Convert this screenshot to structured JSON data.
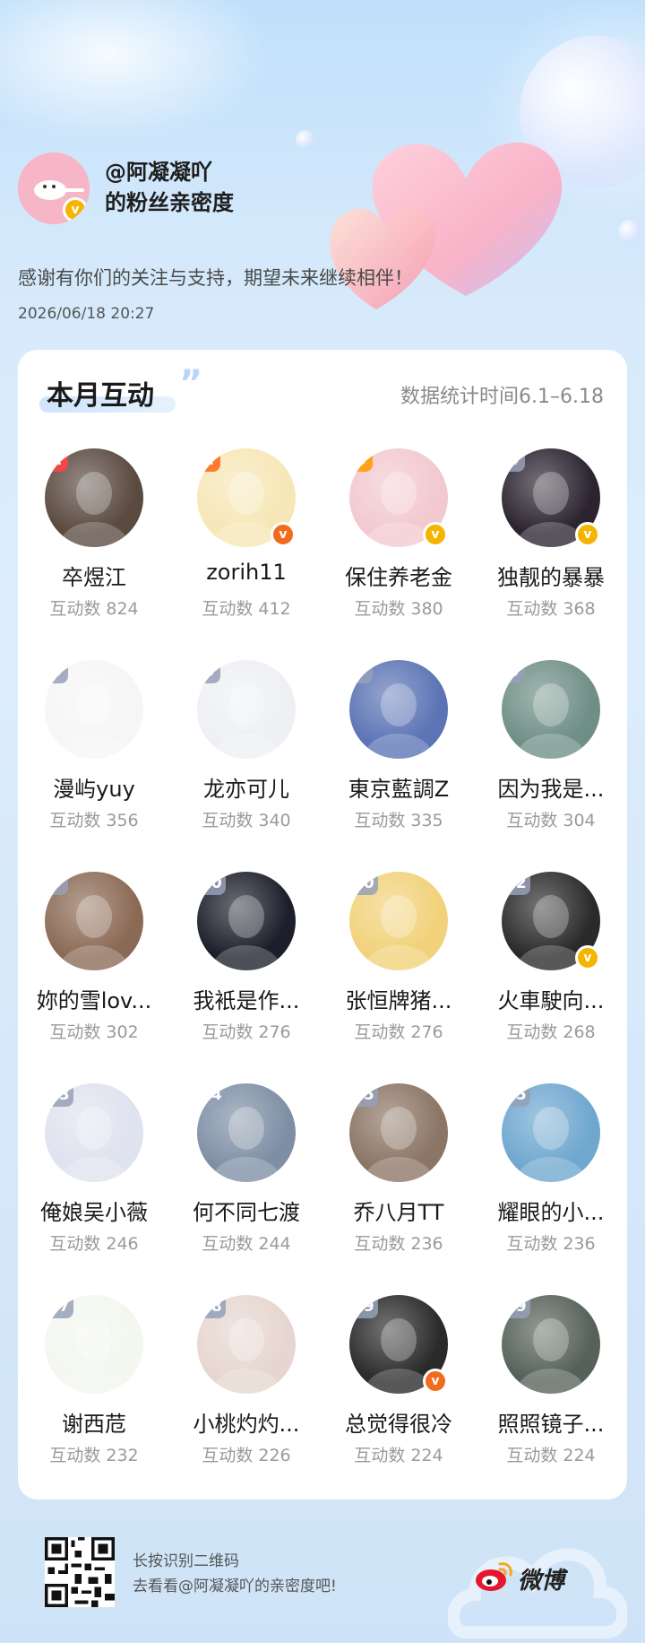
{
  "header": {
    "handle": "@阿凝凝吖",
    "subtitle": "的粉丝亲密度",
    "thanks": "感谢有你们的关注与支持，期望未来继续相伴！",
    "date": "2026/06/18 20:27"
  },
  "card": {
    "title": "本月互动",
    "stat_range": "数据统计时间6.1–6.18",
    "fans": [
      {
        "rank": "1",
        "name": "卒煜江",
        "count": "互动数 824",
        "badge": "",
        "rank_style": "r1",
        "avatar_color": "#5a4a40"
      },
      {
        "rank": "2",
        "name": "zorih11",
        "count": "互动数 412",
        "badge": "orange",
        "rank_style": "r2",
        "avatar_color": "#f6e7b6"
      },
      {
        "rank": "3",
        "name": "保住养老金",
        "count": "互动数 380",
        "badge": "gold",
        "rank_style": "r3",
        "avatar_color": "#f2c9cf"
      },
      {
        "rank": "4",
        "name": "独靓的暴暴",
        "count": "互动数 368",
        "badge": "gold",
        "rank_style": "rn",
        "avatar_color": "#2b2430"
      },
      {
        "rank": "5",
        "name": "漫屿yuy",
        "count": "互动数 356",
        "badge": "",
        "rank_style": "rn",
        "avatar_color": "#f6f6f6"
      },
      {
        "rank": "6",
        "name": "龙亦可儿",
        "count": "互动数 340",
        "badge": "",
        "rank_style": "rn",
        "avatar_color": "#eef0f4"
      },
      {
        "rank": "7",
        "name": "東京藍調Z",
        "count": "互动数 335",
        "badge": "",
        "rank_style": "rn",
        "avatar_color": "#5c74b5"
      },
      {
        "rank": "8",
        "name": "因为我是...",
        "count": "互动数 304",
        "badge": "",
        "rank_style": "rn",
        "avatar_color": "#6f8f86"
      },
      {
        "rank": "9",
        "name": "妳的雪lov...",
        "count": "互动数 302",
        "badge": "",
        "rank_style": "rn",
        "avatar_color": "#8b6a55"
      },
      {
        "rank": "10",
        "name": "我衹是作...",
        "count": "互动数 276",
        "badge": "",
        "rank_style": "rn",
        "avatar_color": "#1c1f2b"
      },
      {
        "rank": "10",
        "name": "张恒牌猪...",
        "count": "互动数 276",
        "badge": "",
        "rank_style": "rn",
        "avatar_color": "#f1d27a"
      },
      {
        "rank": "12",
        "name": "火車駛向...",
        "count": "互动数 268",
        "badge": "gold",
        "rank_style": "rn",
        "avatar_color": "#2a2a2a"
      },
      {
        "rank": "13",
        "name": "俺娘吴小薇",
        "count": "互动数 246",
        "badge": "",
        "rank_style": "rn",
        "avatar_color": "#dfe2ef"
      },
      {
        "rank": "14",
        "name": "何不同七渡",
        "count": "互动数 244",
        "badge": "",
        "rank_style": "rn",
        "avatar_color": "#7e8fa5"
      },
      {
        "rank": "15",
        "name": "乔八月TT",
        "count": "互动数 236",
        "badge": "",
        "rank_style": "rn",
        "avatar_color": "#8b7565"
      },
      {
        "rank": "15",
        "name": "耀眼的小...",
        "count": "互动数 236",
        "badge": "",
        "rank_style": "rn",
        "avatar_color": "#6fa7cf"
      },
      {
        "rank": "17",
        "name": "谢西苊",
        "count": "互动数 232",
        "badge": "",
        "rank_style": "rn",
        "avatar_color": "#f3f7ef"
      },
      {
        "rank": "18",
        "name": "小桃灼灼...",
        "count": "互动数 226",
        "badge": "",
        "rank_style": "rn",
        "avatar_color": "#e6d6cf"
      },
      {
        "rank": "19",
        "name": "总觉得很冷",
        "count": "互动数 224",
        "badge": "orange",
        "rank_style": "rn",
        "avatar_color": "#2a2a2a"
      },
      {
        "rank": "19",
        "name": "照照镜子...",
        "count": "互动数 224",
        "badge": "",
        "rank_style": "rn",
        "avatar_color": "#566259"
      }
    ]
  },
  "footer": {
    "line1": "长按识别二维码",
    "line2": "去看看@阿凝凝吖的亲密度吧!",
    "brand": "微博"
  },
  "colors": {
    "rank1": "#f04848",
    "rank2": "#ff7a30",
    "rank3": "#ffa21a",
    "verified_gold": "#f5b400",
    "verified_orange": "#f06b1c"
  }
}
